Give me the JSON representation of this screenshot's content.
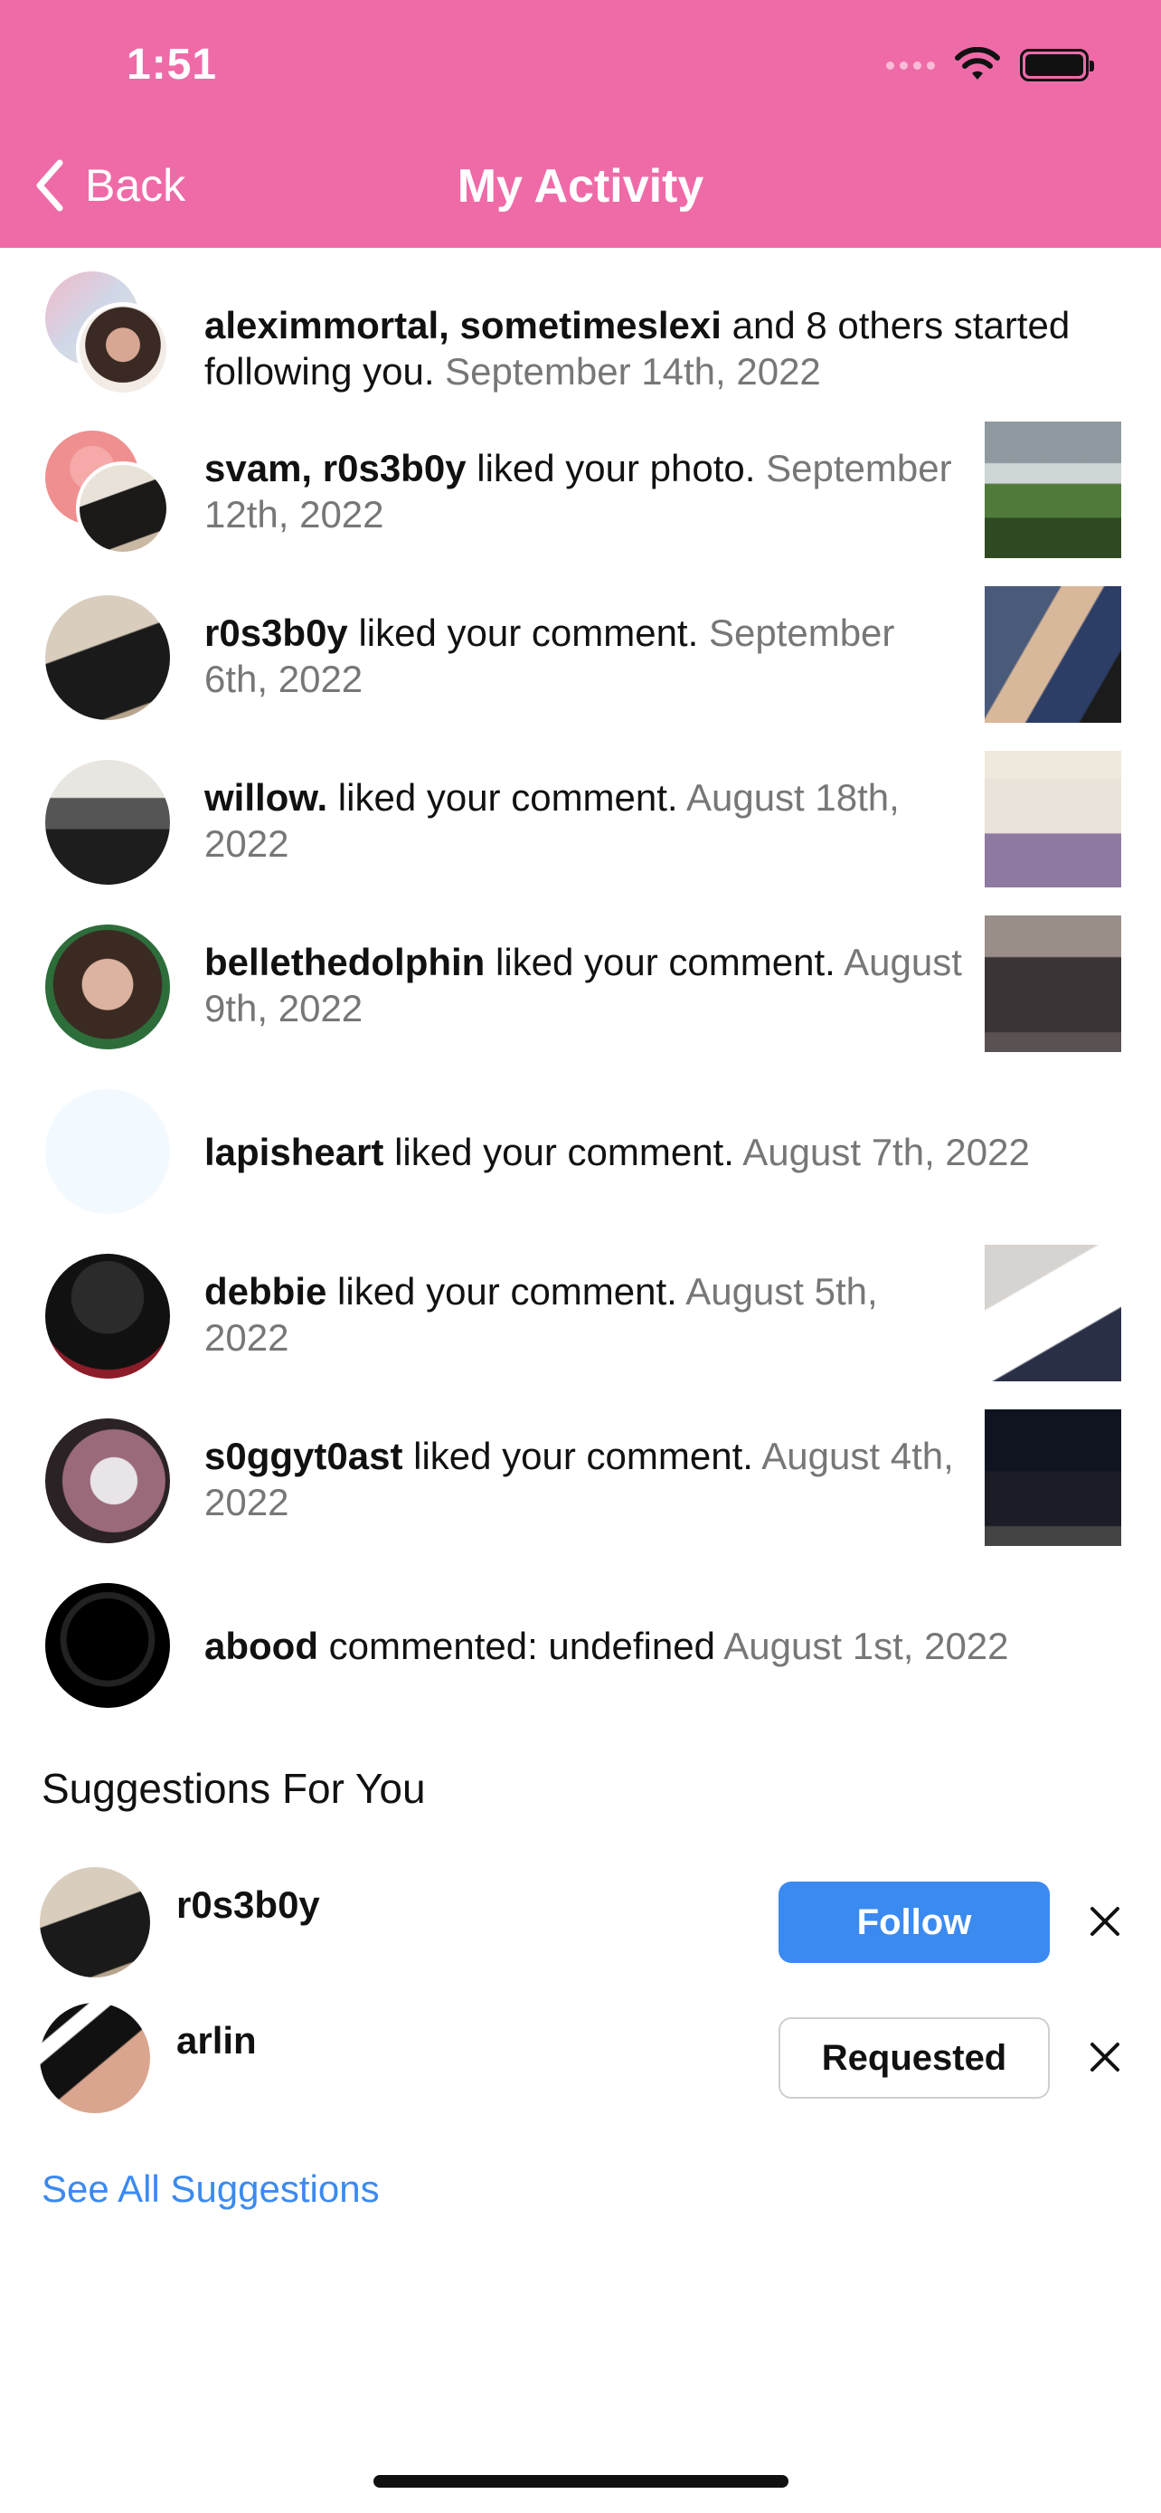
{
  "status_bar": {
    "time": "1:51"
  },
  "nav": {
    "back_label": "Back",
    "title": "My Activity"
  },
  "colors": {
    "header_bg": "#ef6ba8",
    "accent_blue": "#3b8af0",
    "meta_gray": "#777777"
  },
  "activity": [
    {
      "names": "aleximmortal, sometimeslexi",
      "action": " and 8 others started following you.",
      "time": "September 14th, 2022"
    },
    {
      "names": "svam, r0s3b0y",
      "action": " liked your photo.",
      "time": "September 12th, 2022"
    },
    {
      "names": "r0s3b0y",
      "action": " liked your comment.",
      "time": "September 6th, 2022"
    },
    {
      "names": "willow.",
      "action": " liked your comment.",
      "time": "August 18th, 2022"
    },
    {
      "names": "bellethedolphin",
      "action": " liked your comment.",
      "time": "August 9th, 2022"
    },
    {
      "names": "lapisheart",
      "action": " liked your comment.",
      "time": "August 7th, 2022"
    },
    {
      "names": "debbie",
      "action": " liked your comment.",
      "time": "August 5th, 2022"
    },
    {
      "names": "s0ggyt0ast",
      "action": " liked your comment.",
      "time": "August 4th, 2022"
    },
    {
      "names": "abood",
      "action": " commented: undefined",
      "time": "August 1st, 2022"
    }
  ],
  "suggestions": {
    "title": "Suggestions For You",
    "items": [
      {
        "name": "r0s3b0y",
        "button": "Follow"
      },
      {
        "name": "arlin",
        "button": "Requested"
      }
    ],
    "see_all": "See All Suggestions"
  }
}
